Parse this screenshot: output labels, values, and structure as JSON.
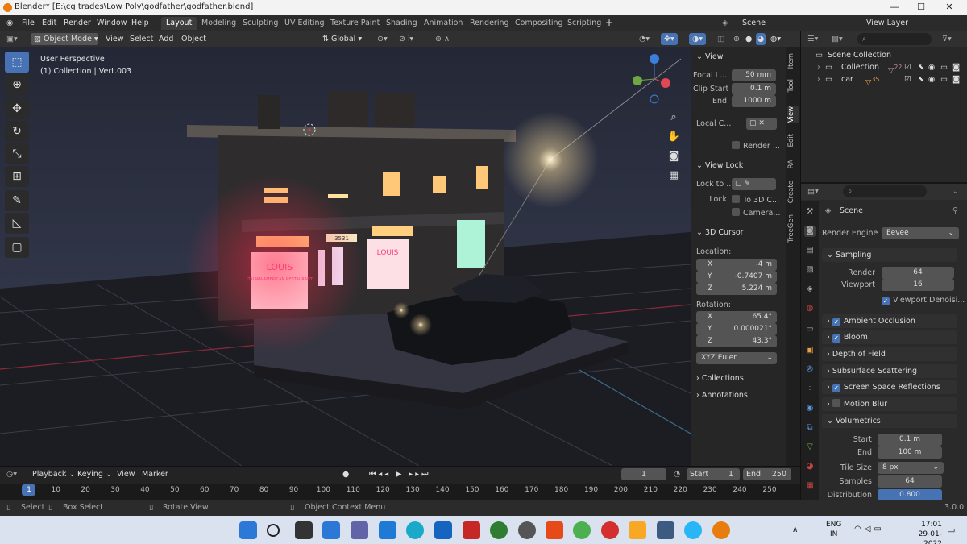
{
  "window": {
    "title": "Blender* [E:\\cg trades\\Low Poly\\godfather\\godfather.blend]",
    "controls": [
      "—",
      "☐",
      "✕"
    ]
  },
  "menu": {
    "items": [
      "File",
      "Edit",
      "Render",
      "Window",
      "Help"
    ],
    "workspaces": [
      "Layout",
      "Modeling",
      "Sculpting",
      "UV Editing",
      "Texture Paint",
      "Shading",
      "Animation",
      "Rendering",
      "Compositing",
      "Scripting"
    ],
    "add": "+",
    "scene": "Scene",
    "view_layer": "View Layer"
  },
  "viewport_header": {
    "mode": "Object Mode",
    "menus": [
      "View",
      "Select",
      "Add",
      "Object"
    ],
    "transform": "Global"
  },
  "viewport": {
    "perspective": "User Perspective",
    "context": "(1) Collection | Vert.003",
    "sign": "LOUIS",
    "sign_sub": "ITALIAN-AMERICAN RESTAURANT",
    "number": "3531"
  },
  "npanel": {
    "view_header": "View",
    "focal_label": "Focal L...",
    "focal": "50 mm",
    "clip_start_label": "Clip Start",
    "clip_start": "0.1 m",
    "end_label": "End",
    "end": "1000 m",
    "local_camera": "Local C...",
    "render_label": "Render ...",
    "view_lock_header": "View Lock",
    "lock_to": "Lock to ...",
    "lock": "Lock",
    "to_3d": "To 3D C...",
    "camera": "Camera...",
    "cursor_header": "3D Cursor",
    "location": "Location:",
    "loc_x": "-4 m",
    "loc_y": "-0.7407 m",
    "loc_z": "5.224 m",
    "rotation": "Rotation:",
    "rot_x": "65.4°",
    "rot_y": "0.000021°",
    "rot_z": "43.3°",
    "rot_mode": "XYZ Euler",
    "collections": "Collections",
    "annotations": "Annotations",
    "x": "X",
    "y": "Y",
    "z": "Z"
  },
  "ntabs": [
    "Item",
    "Tool",
    "View",
    "Edit",
    "RA",
    "Create",
    "TreeGen"
  ],
  "outliner": {
    "scene_collection": "Scene Collection",
    "rows": [
      {
        "name": "Collection",
        "badge": "22"
      },
      {
        "name": "car",
        "badge": "35"
      }
    ]
  },
  "properties": {
    "scene": "Scene",
    "render_engine_label": "Render Engine",
    "render_engine": "Eevee",
    "sampling": "Sampling",
    "render_label": "Render",
    "render": "64",
    "viewport_label": "Viewport",
    "viewport": "16",
    "viewport_denoise": "Viewport Denoisi...",
    "sections": [
      {
        "label": "Ambient Occlusion",
        "check": true
      },
      {
        "label": "Bloom",
        "check": true
      },
      {
        "label": "Depth of Field",
        "check": null
      },
      {
        "label": "Subsurface Scattering",
        "check": null
      },
      {
        "label": "Screen Space Reflections",
        "check": true
      },
      {
        "label": "Motion Blur",
        "check": false
      }
    ],
    "volumetrics": "Volumetrics",
    "start_label": "Start",
    "start": "0.1 m",
    "end_label": "End",
    "end": "100 m",
    "tile_label": "Tile Size",
    "tile": "8 px",
    "samples_label": "Samples",
    "samples": "64",
    "dist_label": "Distribution",
    "distribution": "0.800"
  },
  "timeline": {
    "menus": [
      "Playback",
      "Keying",
      "View",
      "Marker"
    ],
    "current": "1",
    "start_label": "Start",
    "start": "1",
    "end_label": "End",
    "end": "250",
    "ticks": [
      "1",
      "10",
      "20",
      "30",
      "40",
      "50",
      "60",
      "70",
      "80",
      "90",
      "100",
      "110",
      "120",
      "130",
      "140",
      "150",
      "160",
      "170",
      "180",
      "190",
      "200",
      "210",
      "220",
      "230",
      "240",
      "250"
    ]
  },
  "status": {
    "select": "Select",
    "box_select": "Box Select",
    "rotate": "Rotate View",
    "context_menu": "Object Context Menu",
    "version": "3.0.0"
  },
  "taskbar": {
    "lang": "ENG",
    "region": "IN",
    "time": "17:01",
    "date": "29-01-2022"
  }
}
